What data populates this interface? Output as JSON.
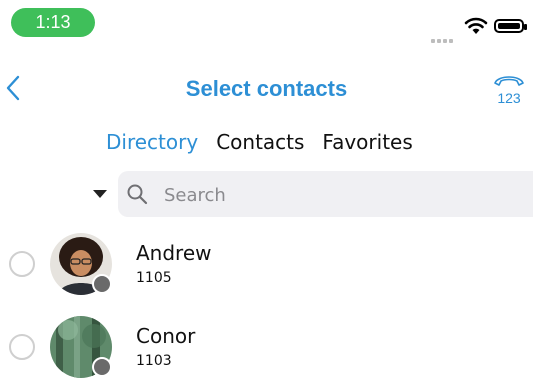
{
  "status_bar": {
    "time": "1:13"
  },
  "nav": {
    "title": "Select contacts"
  },
  "tabs": [
    {
      "label": "Directory",
      "active": true
    },
    {
      "label": "Contacts",
      "active": false
    },
    {
      "label": "Favorites",
      "active": false
    }
  ],
  "search": {
    "placeholder": "Search"
  },
  "contacts": [
    {
      "name": "Andrew",
      "extension": "1105",
      "presence": "offline"
    },
    {
      "name": "Conor",
      "extension": "1103",
      "presence": "offline"
    }
  ],
  "colors": {
    "accent": "#2d8fd5",
    "time_pill": "#3fbf5a",
    "presence_offline": "#6a6a6a"
  }
}
